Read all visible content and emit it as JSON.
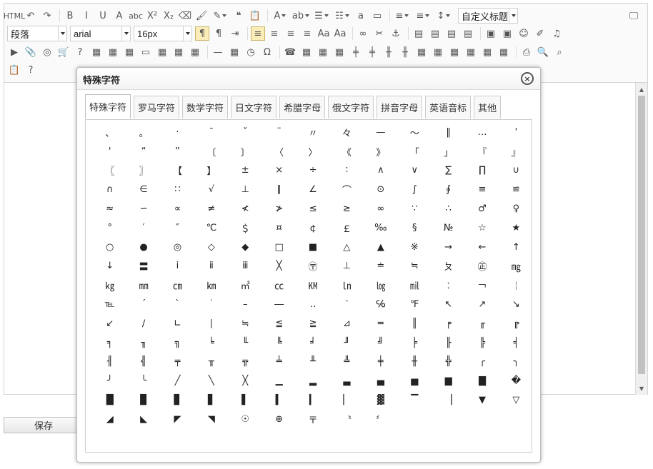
{
  "toolbar": {
    "row1": [
      {
        "name": "html-source-button",
        "glyph": "HTML",
        "cls": "sm"
      },
      {
        "name": "undo-button",
        "glyph": "↶"
      },
      {
        "name": "redo-button",
        "glyph": "↷"
      },
      {
        "name": "sep"
      },
      {
        "name": "bold-button",
        "glyph": "B"
      },
      {
        "name": "italic-button",
        "glyph": "I"
      },
      {
        "name": "underline-button",
        "glyph": "U"
      },
      {
        "name": "font-border-button",
        "glyph": "A"
      },
      {
        "name": "strikethrough-button",
        "glyph": "abc",
        "cls": "sm"
      },
      {
        "name": "superscript-button",
        "glyph": "X²"
      },
      {
        "name": "subscript-button",
        "glyph": "X₂"
      },
      {
        "name": "eraser-button",
        "glyph": "⌫"
      },
      {
        "name": "format-painter-button",
        "glyph": "🖌"
      },
      {
        "name": "autotypeset-button",
        "glyph": "✎",
        "cls": "dd"
      },
      {
        "name": "blockquote-button",
        "glyph": "❝"
      },
      {
        "name": "paste-plain-button",
        "glyph": "📋"
      },
      {
        "name": "sep"
      },
      {
        "name": "forecolor-button",
        "glyph": "A",
        "cls": "dd"
      },
      {
        "name": "backcolor-button",
        "glyph": "ab",
        "cls": "dd"
      },
      {
        "name": "ordered-list-button",
        "glyph": "☰",
        "cls": "dd"
      },
      {
        "name": "unordered-list-button",
        "glyph": "☷",
        "cls": "dd"
      },
      {
        "name": "select-all-button",
        "glyph": "a"
      },
      {
        "name": "clear-doc-button",
        "glyph": "▭"
      },
      {
        "name": "sep"
      },
      {
        "name": "rowspacing-top-button",
        "glyph": "≡",
        "cls": "dd"
      },
      {
        "name": "rowspacing-bottom-button",
        "glyph": "≡",
        "cls": "dd"
      },
      {
        "name": "lineheight-button",
        "glyph": "↕",
        "cls": "dd"
      }
    ],
    "custom_style_label": "自定义标题",
    "paragraph_label": "段落",
    "font_family_label": "arial",
    "font_size_label": "16px",
    "row2": [
      {
        "name": "ltr-direction-button",
        "glyph": "¶",
        "cls": "active"
      },
      {
        "name": "rtl-direction-button",
        "glyph": "¶"
      },
      {
        "name": "indent-button",
        "glyph": "⇥"
      },
      {
        "name": "sep"
      },
      {
        "name": "justify-left-button",
        "glyph": "≡",
        "cls": "active"
      },
      {
        "name": "justify-center-button",
        "glyph": "≡"
      },
      {
        "name": "justify-right-button",
        "glyph": "≡"
      },
      {
        "name": "justify-full-button",
        "glyph": "≡"
      },
      {
        "name": "uppercase-button",
        "glyph": "Aa"
      },
      {
        "name": "lowercase-button",
        "glyph": "Aa"
      },
      {
        "name": "sep"
      },
      {
        "name": "link-button",
        "glyph": "∞"
      },
      {
        "name": "unlink-button",
        "glyph": "✂"
      },
      {
        "name": "anchor-button",
        "glyph": "⚓"
      },
      {
        "name": "sep"
      },
      {
        "name": "image-none-button",
        "glyph": "▤"
      },
      {
        "name": "image-left-button",
        "glyph": "▤"
      },
      {
        "name": "image-right-button",
        "glyph": "▤"
      },
      {
        "name": "image-center-button",
        "glyph": "▤"
      },
      {
        "name": "sep"
      },
      {
        "name": "simple-upload-button",
        "glyph": "▣"
      },
      {
        "name": "insert-image-button",
        "glyph": "▣"
      },
      {
        "name": "emotion-button",
        "glyph": "☺"
      },
      {
        "name": "scrawl-button",
        "glyph": "✐"
      },
      {
        "name": "music-button",
        "glyph": "♫"
      }
    ],
    "row3": [
      {
        "name": "insert-video-button",
        "glyph": "▶"
      },
      {
        "name": "attachment-button",
        "glyph": "📎"
      },
      {
        "name": "insert-frame-button",
        "glyph": "◎"
      },
      {
        "name": "baidu-map-button",
        "glyph": "🛒"
      },
      {
        "name": "help-button",
        "glyph": "?"
      },
      {
        "name": "insert-code-button",
        "glyph": "▦"
      },
      {
        "name": "template-button",
        "glyph": "▦"
      },
      {
        "name": "background-button",
        "glyph": "▦"
      },
      {
        "name": "pagebreak-button",
        "glyph": "▭"
      },
      {
        "name": "webapp-button",
        "glyph": "▦"
      },
      {
        "name": "gmap-button",
        "glyph": "▦"
      },
      {
        "name": "table-grid-button",
        "glyph": "▦"
      },
      {
        "name": "sep"
      },
      {
        "name": "horizontal-rule-button",
        "glyph": "—"
      },
      {
        "name": "date-button",
        "glyph": "▦"
      },
      {
        "name": "time-button",
        "glyph": "◷"
      },
      {
        "name": "special-char-button",
        "glyph": "Ω"
      },
      {
        "name": "sep"
      },
      {
        "name": "telephone-button",
        "glyph": "☎"
      },
      {
        "name": "insert-table-button",
        "glyph": "▦"
      },
      {
        "name": "delete-table-button",
        "glyph": "▦"
      },
      {
        "name": "insert-paragraph-before-table-button",
        "glyph": "▦"
      },
      {
        "name": "insert-row-button",
        "glyph": "╪"
      },
      {
        "name": "delete-row-button",
        "glyph": "╪"
      },
      {
        "name": "insert-col-button",
        "glyph": "╫"
      },
      {
        "name": "delete-col-button",
        "glyph": "╫"
      },
      {
        "name": "merge-cells-button",
        "glyph": "▦"
      },
      {
        "name": "merge-right-button",
        "glyph": "▦"
      },
      {
        "name": "merge-down-button",
        "glyph": "▦"
      },
      {
        "name": "split-cells-button",
        "glyph": "▦"
      },
      {
        "name": "split-rows-button",
        "glyph": "▦"
      },
      {
        "name": "split-cols-button",
        "glyph": "▦"
      },
      {
        "name": "sep"
      },
      {
        "name": "print-button",
        "glyph": "⎙"
      },
      {
        "name": "preview-button",
        "glyph": "🔍"
      },
      {
        "name": "search-replace-button",
        "glyph": "⌕"
      }
    ],
    "row4": [
      {
        "name": "drafts-button",
        "glyph": "📋"
      },
      {
        "name": "help-circle-button",
        "glyph": "?"
      }
    ],
    "fullscreen_glyph": "🖵"
  },
  "save_button_label": "保存",
  "dialog": {
    "title": "特殊字符",
    "close_glyph": "×",
    "tabs": [
      "特殊字符",
      "罗马字符",
      "数学字符",
      "日文字符",
      "希腊字母",
      "俄文字符",
      "拼音字母",
      "英语音标",
      "其他"
    ],
    "active_tab": 0,
    "chars": [
      "、",
      "。",
      "·",
      "ˉ",
      "ˇ",
      "¨",
      "〃",
      "々",
      "—",
      "～",
      "‖",
      "…",
      "'",
      "'",
      "“",
      "”",
      "〔",
      "〕",
      "〈",
      "〉",
      "《",
      "》",
      "「",
      "」",
      "『",
      "』",
      "〖",
      "〗",
      "【",
      "】",
      "±",
      "×",
      "÷",
      "∶",
      "∧",
      "∨",
      "∑",
      "∏",
      "∪",
      "∩",
      "∈",
      "∷",
      "√",
      "⊥",
      "∥",
      "∠",
      "⌒",
      "⊙",
      "∫",
      "∮",
      "≡",
      "≌",
      "≈",
      "∽",
      "∝",
      "≠",
      "≮",
      "≯",
      "≤",
      "≥",
      "∞",
      "∵",
      "∴",
      "♂",
      "♀",
      "°",
      "′",
      "″",
      "℃",
      "＄",
      "¤",
      "￠",
      "￡",
      "‰",
      "§",
      "№",
      "☆",
      "★",
      "○",
      "●",
      "◎",
      "◇",
      "◆",
      "□",
      "■",
      "△",
      "▲",
      "※",
      "→",
      "←",
      "↑",
      "↓",
      "〓",
      "ⅰ",
      "ⅱ",
      "ⅲ",
      "╳",
      "〶",
      "⊥",
      "≐",
      "≒",
      "ㄆ",
      "㊣",
      "㎎",
      "㎏",
      "㎜",
      "㎝",
      "㎞",
      "㎡",
      "㏄",
      "㏎",
      "㏑",
      "㏒",
      "㏕",
      "︰",
      "￢",
      "￤",
      "℡",
      "ˊ",
      "ˋ",
      "˙",
      "–",
      "―",
      "‥",
      "‵",
      "℅",
      "℉",
      "↖",
      "↗",
      "↘",
      "↙",
      "∕",
      "∟",
      "∣",
      "≒",
      "≦",
      "≧",
      "⊿",
      "═",
      "║",
      "╒",
      "╓",
      "╔",
      "╕",
      "╖",
      "╗",
      "╘",
      "╙",
      "╚",
      "╛",
      "╜",
      "╝",
      "╞",
      "╟",
      "╠",
      "╡",
      "╢",
      "╣",
      "╤",
      "╥",
      "╦",
      "╧",
      "╨",
      "╩",
      "╪",
      "╫",
      "╬",
      "╭",
      "╮",
      "╯",
      "╰",
      "╱",
      "╲",
      "╳",
      "▁",
      "▂",
      "▃",
      "▄",
      "▅",
      "▆",
      "▇",
      "�",
      "█",
      "▉",
      "▊",
      "▋",
      "▌",
      "▍",
      "▎",
      "▏",
      "▓",
      "▔",
      "▕",
      "▼",
      "▽",
      "◢",
      "◣",
      "◤",
      "◥",
      "☉",
      "⊕",
      "〒",
      "〝",
      "〞"
    ]
  },
  "colors": {
    "accent_active": "#fbedb8",
    "accent_border": "#c9b36b"
  }
}
